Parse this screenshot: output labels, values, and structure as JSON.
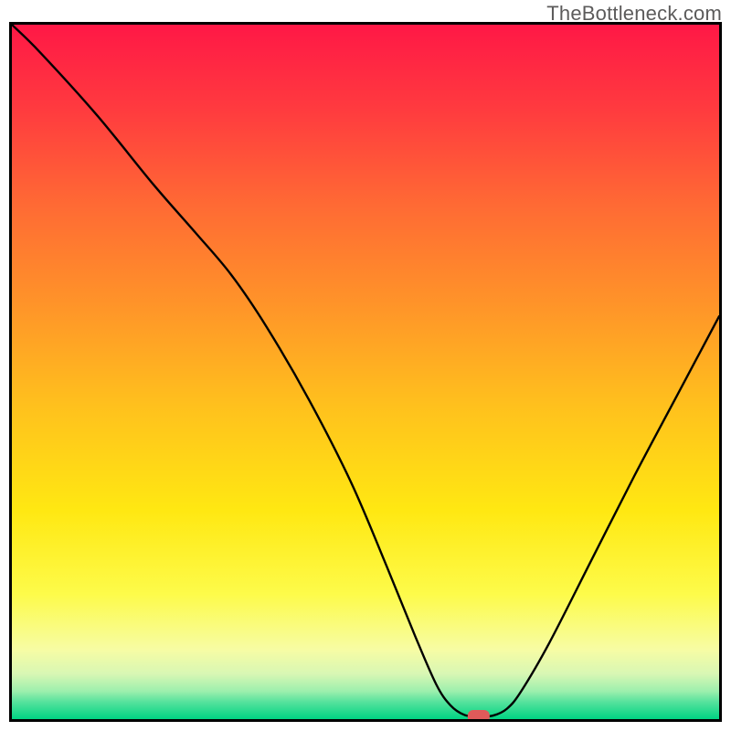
{
  "watermark": "TheBottleneck.com",
  "chart_data": {
    "type": "line",
    "title": "",
    "xlabel": "",
    "ylabel": "",
    "xlim": [
      0,
      100
    ],
    "ylim": [
      0,
      100
    ],
    "background_gradient_stops": [
      {
        "offset": 0.0,
        "color": "#ff1846"
      },
      {
        "offset": 0.12,
        "color": "#ff3a3f"
      },
      {
        "offset": 0.26,
        "color": "#ff6a34"
      },
      {
        "offset": 0.4,
        "color": "#ff9329"
      },
      {
        "offset": 0.55,
        "color": "#ffc11d"
      },
      {
        "offset": 0.7,
        "color": "#ffe812"
      },
      {
        "offset": 0.82,
        "color": "#fdfb4a"
      },
      {
        "offset": 0.9,
        "color": "#f7fca4"
      },
      {
        "offset": 0.935,
        "color": "#d8f7b4"
      },
      {
        "offset": 0.96,
        "color": "#9cefad"
      },
      {
        "offset": 0.975,
        "color": "#57e29d"
      },
      {
        "offset": 1.0,
        "color": "#00d483"
      }
    ],
    "series": [
      {
        "name": "bottleneck-curve",
        "color": "#000000",
        "points": [
          {
            "x": 0.0,
            "y": 100.0
          },
          {
            "x": 4.0,
            "y": 96.0
          },
          {
            "x": 12.0,
            "y": 87.0
          },
          {
            "x": 20.0,
            "y": 77.0
          },
          {
            "x": 26.0,
            "y": 70.0
          },
          {
            "x": 31.0,
            "y": 64.0
          },
          {
            "x": 36.0,
            "y": 56.5
          },
          {
            "x": 42.0,
            "y": 46.0
          },
          {
            "x": 48.0,
            "y": 34.0
          },
          {
            "x": 53.0,
            "y": 22.0
          },
          {
            "x": 57.0,
            "y": 12.0
          },
          {
            "x": 60.0,
            "y": 5.0
          },
          {
            "x": 62.0,
            "y": 2.0
          },
          {
            "x": 64.0,
            "y": 0.6
          },
          {
            "x": 66.0,
            "y": 0.4
          },
          {
            "x": 68.0,
            "y": 0.5
          },
          {
            "x": 70.0,
            "y": 1.5
          },
          {
            "x": 72.0,
            "y": 4.0
          },
          {
            "x": 76.0,
            "y": 11.0
          },
          {
            "x": 82.0,
            "y": 23.0
          },
          {
            "x": 88.0,
            "y": 35.0
          },
          {
            "x": 94.0,
            "y": 46.5
          },
          {
            "x": 100.0,
            "y": 58.0
          }
        ]
      }
    ],
    "marker": {
      "x": 66.0,
      "y": 0.4,
      "shape": "rounded-rect",
      "color": "#e05a5a"
    }
  }
}
